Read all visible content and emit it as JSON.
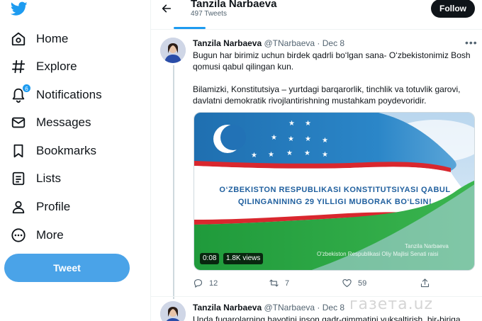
{
  "sidebar": {
    "logo": "twitter-bird-icon",
    "items": [
      {
        "label": "Home",
        "icon": "home-icon"
      },
      {
        "label": "Explore",
        "icon": "hashtag-icon"
      },
      {
        "label": "Notifications",
        "icon": "bell-icon",
        "badge": "6"
      },
      {
        "label": "Messages",
        "icon": "envelope-icon"
      },
      {
        "label": "Bookmarks",
        "icon": "bookmark-icon"
      },
      {
        "label": "Lists",
        "icon": "list-icon"
      },
      {
        "label": "Profile",
        "icon": "person-icon"
      },
      {
        "label": "More",
        "icon": "more-circle-icon"
      }
    ],
    "tweet_button": "Tweet"
  },
  "header": {
    "name": "Tanzila Narbaeva",
    "tweet_count": "497 Tweets",
    "follow_label": "Follow"
  },
  "tweets": [
    {
      "name": "Tanzila Narbaeva",
      "handle": "@TNarbaeva",
      "date": "Dec 8",
      "paragraph1": "Bugun har birimiz uchun birdek qadrli bo‘lgan sana- O‘zbekistonimiz Bosh qomusi qabul qilingan kun.",
      "paragraph2": "Bilamizki, Konstitutsiya – yurtdagi barqarorlik, tinchlik va totuvlik garovi, davlatni demokratik rivojlantirishning mustahkam poydevoridir.",
      "media": {
        "line1": "O‘ZBEKISTON   RESPUBLIKASI   KONSTITUTSIYASI   QABUL",
        "line2": "QILINGANINING 29 YILLIGI MUBORAK BO‘LSIN!",
        "signature1": "Tanzila  Narbaeva",
        "signature2": "O'zbekiston Respublikasi Oliy Majlisi Senati raisi",
        "duration": "0:08",
        "views": "1.8K views"
      },
      "replies": "12",
      "retweets": "7",
      "likes": "59"
    },
    {
      "name": "Tanzila Narbaeva",
      "handle": "@TNarbaeva",
      "date": "Dec 8",
      "text": "Unda fuqarolarning hayotini inson qadr-qimmatini yuksaltirish, bir-biriga"
    }
  ],
  "watermark": "газета.uz",
  "colors": {
    "accent": "#1d9bf0",
    "tweet_button": "#4aa3e8",
    "text": "#0f1419",
    "muted": "#536471"
  }
}
